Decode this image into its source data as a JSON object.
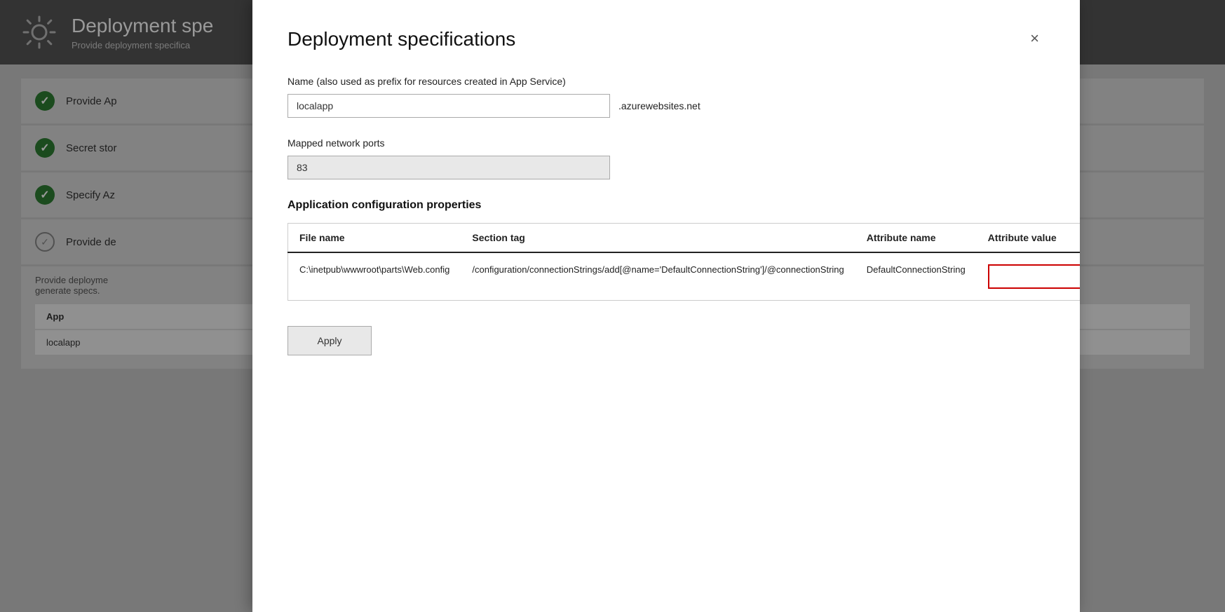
{
  "background": {
    "gear_icon_label": "gear-icon",
    "title": "Deployment spe",
    "subtitle": "Provide deployment specifica",
    "steps": [
      {
        "id": "step-provide-app",
        "label": "Provide Ap",
        "status": "complete"
      },
      {
        "id": "step-secret-store",
        "label": "Secret stor",
        "status": "complete"
      },
      {
        "id": "step-specify-az",
        "label": "Specify Az",
        "status": "complete"
      },
      {
        "id": "step-provide-de",
        "label": "Provide de",
        "status": "outline"
      }
    ],
    "step_detail": {
      "description": "Provide deployme\ngenerate specs.",
      "table_header_label": "App",
      "table_row_value": "localapp"
    }
  },
  "modal": {
    "title": "Deployment specifications",
    "close_label": "×",
    "name_field": {
      "label": "Name (also used as prefix for resources created in App Service)",
      "value": "localapp",
      "domain_suffix": ".azurewebsites.net"
    },
    "ports_field": {
      "label": "Mapped network ports",
      "value": "83"
    },
    "config_section": {
      "title": "Application configuration properties",
      "columns": [
        {
          "id": "file-name",
          "label": "File name"
        },
        {
          "id": "section-tag",
          "label": "Section tag"
        },
        {
          "id": "attribute-name",
          "label": "Attribute name"
        },
        {
          "id": "attribute-value",
          "label": "Attribute value"
        }
      ],
      "rows": [
        {
          "file_name": "C:\\inetpub\\wwwroot\\parts\\Web.config",
          "section_tag": "/configuration/connectionStrings/add[@name='DefaultConnectionString']/@connectionString",
          "attribute_name": "DefaultConnectionString",
          "attribute_value": ""
        }
      ]
    },
    "apply_button_label": "Apply"
  }
}
